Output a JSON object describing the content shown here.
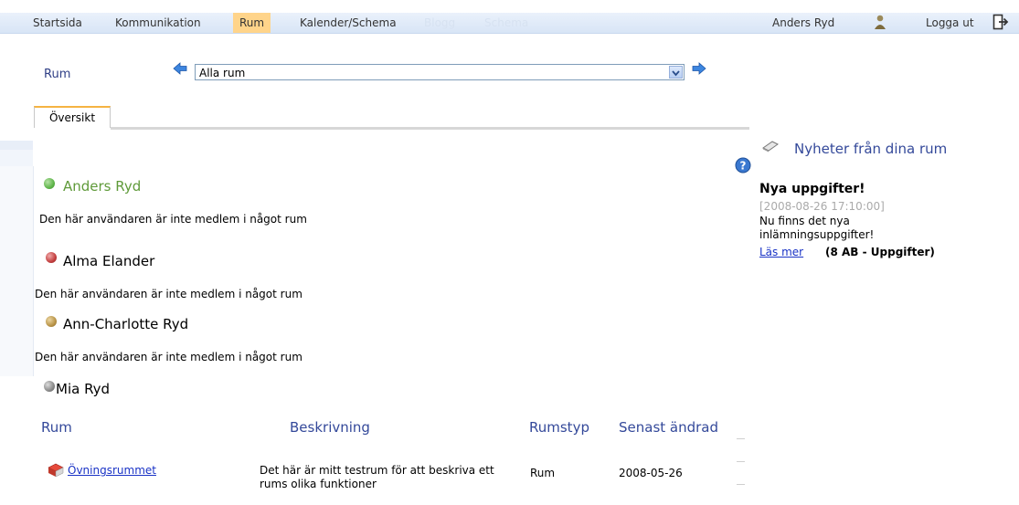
{
  "nav": {
    "items": [
      "Startsida",
      "Kommunikation",
      "Rum",
      "Kalender/Schema"
    ],
    "faded": [
      "Blogg",
      "Schema"
    ],
    "active": "Rum",
    "user": "Anders Ryd",
    "logout": "Logga ut"
  },
  "selector": {
    "label": "Rum",
    "value": "Alla rum"
  },
  "tabs": [
    "Översikt"
  ],
  "members": [
    {
      "name": "Anders Ryd",
      "note": "Den här användaren är inte medlem i något rum",
      "color": "#5fb54a"
    },
    {
      "name": "Alma Elander",
      "note": "Den här användaren är inte medlem i något rum",
      "color": "#c33f3f"
    },
    {
      "name": "Ann-Charlotte Ryd",
      "note": "Den här användaren är inte medlem i något rum",
      "color": "#b89347"
    },
    {
      "name": "Mia Ryd",
      "note": "",
      "color": "#8a8a8a"
    }
  ],
  "table": {
    "headers": [
      "Rum",
      "Beskrivning",
      "Rumstyp",
      "Senast ändrad"
    ],
    "rows": [
      {
        "name": "Övningsrummet",
        "description": "Det här är mitt testrum för att beskriva ett rums olika funktioner",
        "type": "Rum",
        "date": "2008-05-26"
      }
    ]
  },
  "news": {
    "title": "Nyheter från dina rum",
    "headline": "Nya uppgifter!",
    "date": "[2008-08-26 17:10:00]",
    "body": "Nu finns det nya inlämningsuppgifter!",
    "more": "Läs mer",
    "room": "(8 AB - Uppgifter)"
  }
}
